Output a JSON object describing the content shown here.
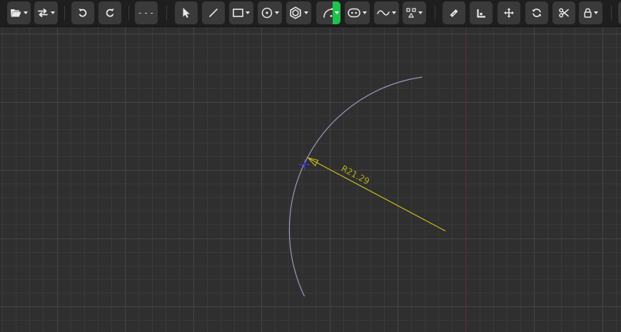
{
  "toolbar": {
    "buttons": [
      {
        "id": "open",
        "icon": "folder-open-icon",
        "has_menu": true
      },
      {
        "id": "swap",
        "icon": "swap-arrows-icon",
        "has_menu": true
      },
      {
        "id": "undo",
        "icon": "undo-icon",
        "has_menu": false
      },
      {
        "id": "redo",
        "icon": "redo-icon",
        "has_menu": false
      },
      {
        "id": "construction-line",
        "icon": "dashed-line-icon",
        "label": "---",
        "has_menu": false
      },
      {
        "id": "select",
        "icon": "pointer-icon",
        "has_menu": false
      },
      {
        "id": "line",
        "icon": "line-icon",
        "has_menu": false
      },
      {
        "id": "rectangle",
        "icon": "rectangle-icon",
        "has_menu": true
      },
      {
        "id": "circle",
        "icon": "circle-icon",
        "has_menu": true
      },
      {
        "id": "polygon",
        "icon": "hexagon-icon",
        "has_menu": true
      },
      {
        "id": "arc",
        "icon": "arc-icon",
        "has_menu": true,
        "active": true
      },
      {
        "id": "slot",
        "icon": "slot-icon",
        "has_menu": true
      },
      {
        "id": "spline",
        "icon": "spline-icon",
        "has_menu": true
      },
      {
        "id": "points",
        "icon": "points-icon",
        "has_menu": true
      },
      {
        "id": "dimension",
        "icon": "ruler-icon",
        "has_menu": false
      },
      {
        "id": "constraint",
        "icon": "square-corner-icon",
        "has_menu": false
      },
      {
        "id": "move",
        "icon": "move-icon",
        "has_menu": false
      },
      {
        "id": "rotate",
        "icon": "rotate-icon",
        "has_menu": false
      },
      {
        "id": "trim",
        "icon": "scissors-icon",
        "has_menu": false
      },
      {
        "id": "lock",
        "icon": "lock-icon",
        "has_menu": true
      }
    ]
  },
  "canvas": {
    "dimension_label": "R21.29"
  },
  "colors": {
    "toolbar_bg": "#1e1e1e",
    "button_bg": "#3a3a3a",
    "active_accent": "#1fc24b",
    "canvas_bg": "#2f2f2f",
    "grid_minor": "#393939",
    "grid_major": "#454545",
    "axis_vertical": "#5e2f30",
    "arc_stroke": "#9a9bc0",
    "dimension_stroke": "#c8bc1e",
    "center_marker": "#3a3ad0"
  }
}
